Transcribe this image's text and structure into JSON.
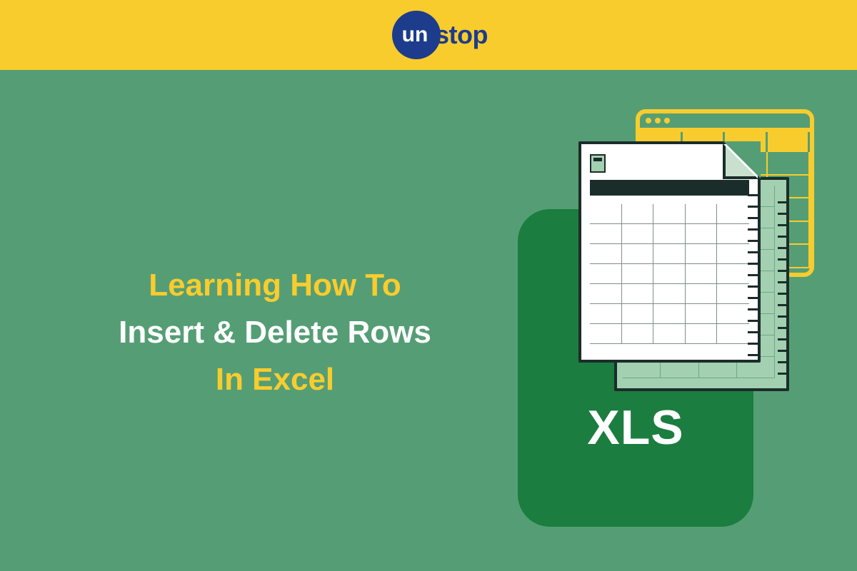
{
  "brand": {
    "logo_left": "un",
    "logo_right": "stop"
  },
  "headline": {
    "line1": "Learning How To",
    "line2": "Insert & Delete  Rows",
    "line3": "In Excel"
  },
  "file": {
    "ext_label": "XLS"
  },
  "colors": {
    "band": "#f9cc2d",
    "bg": "#559e75",
    "file": "#1b7d3f",
    "brand_blue": "#1d3c8c"
  }
}
